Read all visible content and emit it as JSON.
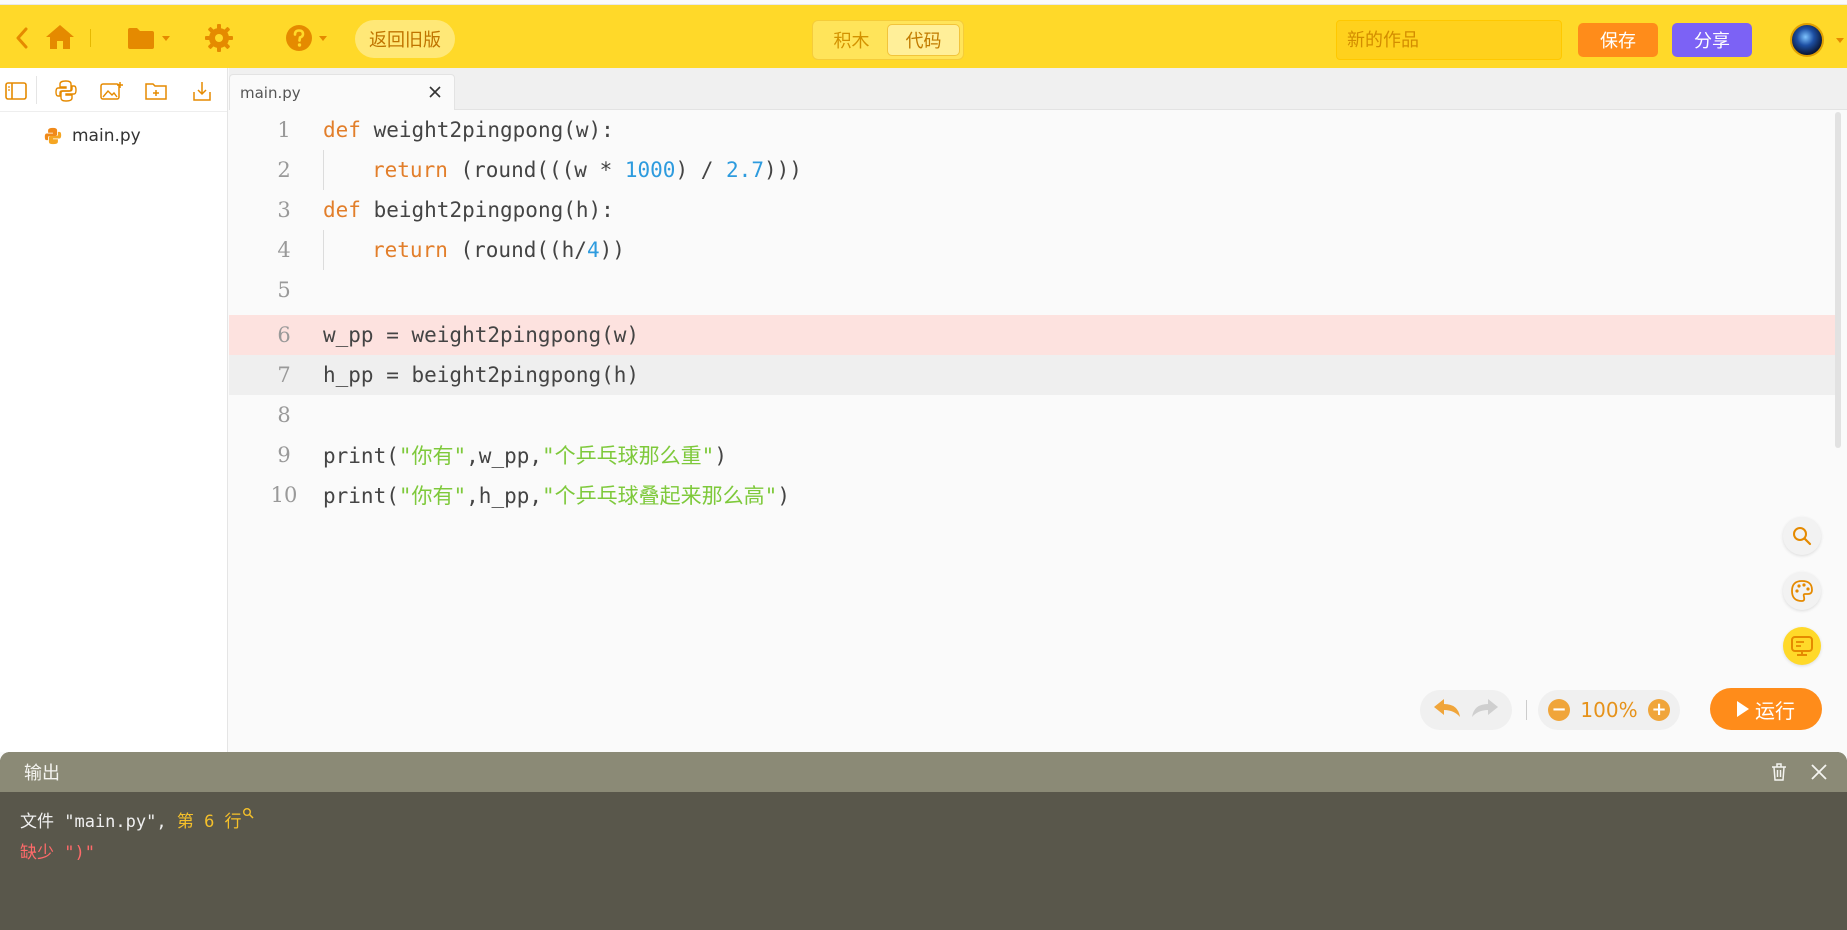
{
  "topbar": {
    "old_version_label": "返回旧版",
    "mode_tabs": [
      {
        "label": "积木",
        "active": false
      },
      {
        "label": "代码",
        "active": true
      }
    ],
    "title_placeholder": "新的作品",
    "save_label": "保存",
    "share_label": "分享"
  },
  "sidebar": {
    "files": [
      {
        "name": "main.py"
      }
    ]
  },
  "editor": {
    "tab_name": "main.py",
    "lines": [
      {
        "no": "1"
      },
      {
        "no": "2"
      },
      {
        "no": "3"
      },
      {
        "no": "4"
      },
      {
        "no": "5"
      },
      {
        "no": "6"
      },
      {
        "no": "7"
      },
      {
        "no": "8"
      },
      {
        "no": "9"
      },
      {
        "no": "10"
      }
    ],
    "code": {
      "l1_kw": "def",
      "l1_rest": " weight2pingpong(w):",
      "l2_kw": "return",
      "l2_a": " (round(((w * ",
      "l2_n1": "1000",
      "l2_b": ") / ",
      "l2_n2": "2.7",
      "l2_c": ")))",
      "l3_kw": "def",
      "l3_rest": " beight2pingpong(h):",
      "l4_kw": "return",
      "l4_a": " (round((h/",
      "l4_n": "4",
      "l4_b": "))",
      "l6": "w_pp = weight2pingpong(w)",
      "l7": "h_pp = beight2pingpong(h)",
      "l9_a": "print(",
      "l9_s1": "\"你有\"",
      "l9_b": ",w_pp,",
      "l9_s2": "\"个乒乓球那么重\"",
      "l9_c": ")",
      "l10_a": "print(",
      "l10_s1": "\"你有\"",
      "l10_b": ",h_pp,",
      "l10_s2": "\"个乒乓球叠起来那么高\"",
      "l10_c": ")"
    },
    "zoom_level": "100%",
    "run_label": "运行"
  },
  "output": {
    "title": "输出",
    "line1_prefix": "文件 \"main.py\", ",
    "line1_loc": "第 6 行",
    "line2_error": "缺少 \")\""
  },
  "colors": {
    "topbar": "#ffd929",
    "keyword": "#e27e2a",
    "number": "#2d9bde",
    "string": "#7ec93b",
    "error_line": "#fde2df",
    "save": "#ff8c1a",
    "share": "#7c62f5"
  }
}
